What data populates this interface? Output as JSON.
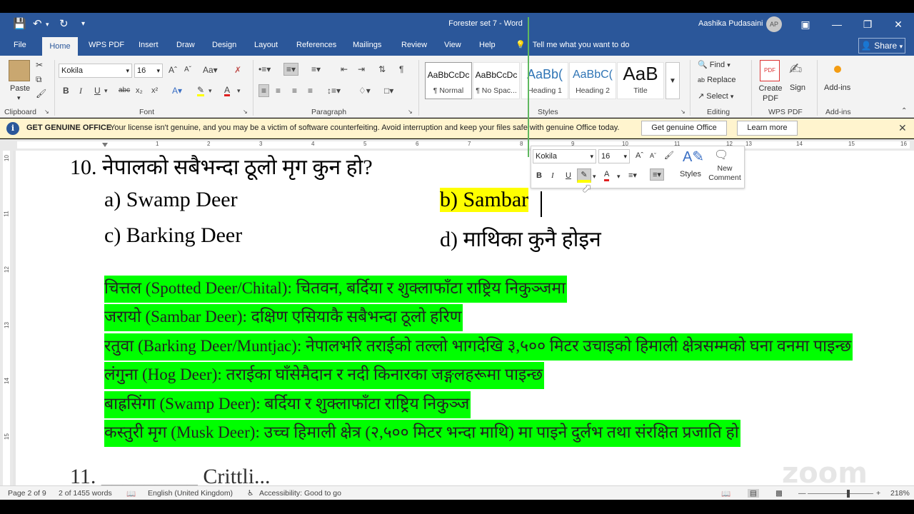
{
  "titlebar": {
    "doc_title": "Forester set 7  -  Word",
    "user_name": "Aashika Pudasaini",
    "avatar_initials": "AP"
  },
  "tabs": [
    "File",
    "Home",
    "WPS PDF",
    "Insert",
    "Draw",
    "Design",
    "Layout",
    "References",
    "Mailings",
    "Review",
    "View",
    "Help"
  ],
  "tellme": "Tell me what you want to do",
  "share_label": "Share",
  "ribbon": {
    "paste_label": "Paste",
    "clipboard_label": "Clipboard",
    "font_name": "Kokila",
    "font_size": "16",
    "font_label": "Font",
    "paragraph_label": "Paragraph",
    "styles_label": "Styles",
    "styles": [
      {
        "sample": "AaBbCcDc",
        "name": "¶ Normal"
      },
      {
        "sample": "AaBbCcDc",
        "name": "¶ No Spac..."
      },
      {
        "sample": "AaBb(",
        "name": "Heading 1"
      },
      {
        "sample": "AaBbC(",
        "name": "Heading 2"
      },
      {
        "sample": "AaB",
        "name": "Title"
      }
    ],
    "find_label": "Find",
    "replace_label": "Replace",
    "select_label": "Select",
    "editing_label": "Editing",
    "create_pdf_label": "Create PDF",
    "sign_label": "Sign",
    "wps_pdf_label": "WPS PDF",
    "addins_label": "Add-ins",
    "addins_group_label": "Add-ins"
  },
  "message_bar": {
    "title": "GET GENUINE OFFICE",
    "text": "Your license isn't genuine, and you may be a victim of software counterfeiting. Avoid interruption and keep your files safe with genuine Office today.",
    "button_get": "Get genuine Office",
    "button_learn": "Learn more"
  },
  "ruler_numbers": [
    "1",
    "2",
    "3",
    "4",
    "5",
    "6",
    "7",
    "8",
    "9",
    "10",
    "11",
    "12",
    "13",
    "14",
    "15",
    "16"
  ],
  "vruler_numbers": [
    "10",
    "11",
    "12",
    "13",
    "14",
    "15"
  ],
  "document": {
    "question": "10. नेपालको सबैभन्दा ठूलो मृग कुन हो?",
    "option_a": "a) Swamp Deer",
    "option_b": "b) Sambar",
    "option_c": "c) Barking Deer",
    "option_d": "d) माथिका कुनै होइन",
    "notes": [
      "चित्तल (Spotted Deer/Chital): चितवन, बर्दिया र शुक्लाफाँटा राष्ट्रिय निकुञ्जमा",
      "जरायो (Sambar Deer): दक्षिण एसियाकै सबैभन्दा ठूलो हरिण",
      "रतुवा (Barking Deer/Muntjac): नेपालभरि तराईको तल्लो भागदेखि ३,५०० मिटर उचाइको हिमाली क्षेत्रसम्मको घना वनमा पाइन्छ",
      "लंगुना (Hog Deer): तराईका घाँसेमैदान र नदी किनारका जङ्गलहरूमा पाइन्छ",
      "बाह्रसिंगा (Swamp Deer): बर्दिया र शुक्लाफाँटा राष्ट्रिय निकुञ्ज",
      "कस्तुरी मृग (Musk Deer): उच्च हिमाली क्षेत्र (२,५०० मिटर भन्दा माथि) मा पाइने दुर्लभ तथा संरक्षित प्रजाति हो"
    ],
    "next_line_partial": "11. _________ Crittli... "
  },
  "minibar": {
    "font_name": "Kokila",
    "font_size": "16",
    "styles_label": "Styles",
    "new_comment_label": "New Comment"
  },
  "statusbar": {
    "page": "Page 2 of 9",
    "words": "2 of 1455 words",
    "language": "English (United Kingdom)",
    "accessibility": "Accessibility: Good to go",
    "zoom": "218%"
  },
  "watermark": "zoom",
  "colors": {
    "word_blue": "#2b579a",
    "highlight_green": "#00ff00",
    "highlight_yellow": "#ffff00",
    "message_bar": "#fff4ce"
  }
}
